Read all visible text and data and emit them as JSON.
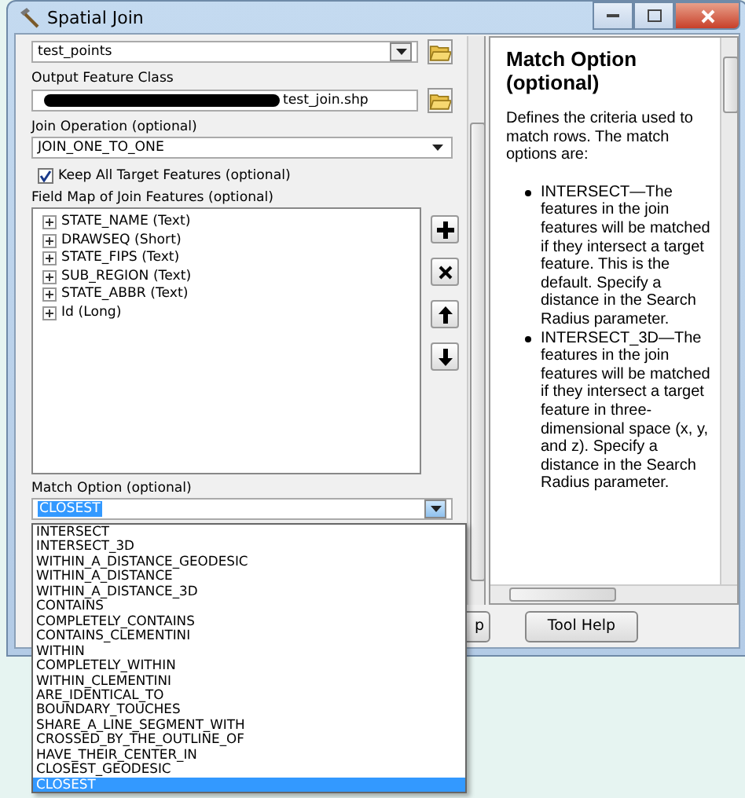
{
  "window": {
    "title": "Spatial Join"
  },
  "form": {
    "target_features": {
      "value": "test_points"
    },
    "output_feature_class": {
      "label": "Output Feature Class",
      "value": "test_join.shp"
    },
    "join_operation": {
      "label": "Join Operation (optional)",
      "value": "JOIN_ONE_TO_ONE"
    },
    "keep_all": {
      "label": "Keep All Target Features (optional)",
      "checked": true
    },
    "field_map": {
      "label": "Field Map of Join Features (optional)",
      "fields": [
        {
          "label": "STATE_NAME (Text)",
          "expanded": false
        },
        {
          "label": "DRAWSEQ (Short)",
          "expanded": false
        },
        {
          "label": "STATE_FIPS (Text)",
          "expanded": false
        },
        {
          "label": "SUB_REGION (Text)",
          "expanded": false
        },
        {
          "label": "STATE_ABBR (Text)",
          "expanded": false
        },
        {
          "label": "Id (Long)",
          "expanded": false
        }
      ]
    },
    "match_option": {
      "label": "Match Option (optional)",
      "value": "CLOSEST",
      "options": [
        {
          "label": "INTERSECT",
          "selected": false
        },
        {
          "label": "INTERSECT_3D",
          "selected": false
        },
        {
          "label": "WITHIN_A_DISTANCE_GEODESIC",
          "selected": false
        },
        {
          "label": "WITHIN_A_DISTANCE",
          "selected": false
        },
        {
          "label": "WITHIN_A_DISTANCE_3D",
          "selected": false
        },
        {
          "label": "CONTAINS",
          "selected": false
        },
        {
          "label": "COMPLETELY_CONTAINS",
          "selected": false
        },
        {
          "label": "CONTAINS_CLEMENTINI",
          "selected": false
        },
        {
          "label": "WITHIN",
          "selected": false
        },
        {
          "label": "COMPLETELY_WITHIN",
          "selected": false
        },
        {
          "label": "WITHIN_CLEMENTINI",
          "selected": false
        },
        {
          "label": "ARE_IDENTICAL_TO",
          "selected": false
        },
        {
          "label": "BOUNDARY_TOUCHES",
          "selected": false
        },
        {
          "label": "SHARE_A_LINE_SEGMENT_WITH",
          "selected": false
        },
        {
          "label": "CROSSED_BY_THE_OUTLINE_OF",
          "selected": false
        },
        {
          "label": "HAVE_THEIR_CENTER_IN",
          "selected": false
        },
        {
          "label": "CLOSEST_GEODESIC",
          "selected": false
        },
        {
          "label": "CLOSEST",
          "selected": true
        }
      ]
    }
  },
  "buttons": [
    {
      "label": "p"
    }
  ],
  "help": {
    "title": "Match Option (optional)",
    "intro": "Defines the criteria used to match rows. The match options are:",
    "items": [
      "INTERSECT—The features in the join features will be matched if they intersect a target feature. This is the default. Specify a distance in the Search Radius parameter.",
      "INTERSECT_3D—The features in the join features will be matched if they intersect a target feature in three-dimensional space (x, y, and z). Specify a distance in the Search Radius parameter."
    ]
  },
  "help_button": {
    "label": "Tool Help"
  }
}
